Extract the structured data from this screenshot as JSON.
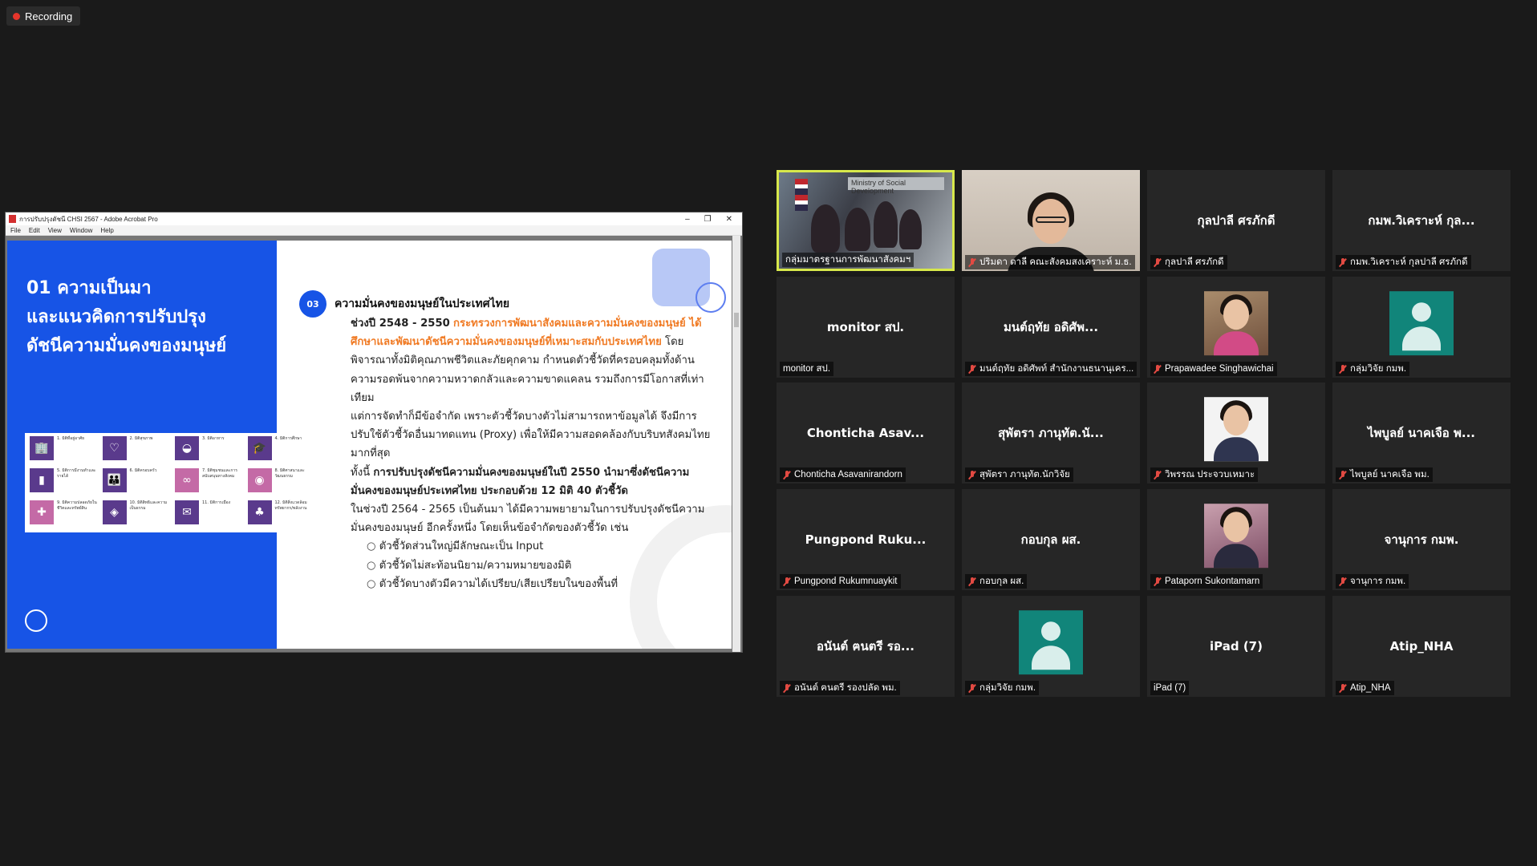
{
  "recording": {
    "label": "Recording"
  },
  "acrobat": {
    "title": "การปรับปรุงดัชนี CHSI 2567 - Adobe Acrobat Pro",
    "menu": [
      "File",
      "Edit",
      "View",
      "Window",
      "Help"
    ],
    "window_controls": [
      "‒",
      "❐",
      "✕"
    ]
  },
  "slide": {
    "heading": [
      "01 ความเป็นมา",
      "และแนวคิดการปรับปรุง",
      "ดัชนีความมั่นคงของมนุษย์"
    ],
    "section_number": "03",
    "section_title": "ความมั่นคงของมนุษย์ในประเทศไทย",
    "p1_lead": "ช่วงปี 2548 - 2550",
    "p1_orange": "กระทรวงการพัฒนาสังคมและความมั่นคงของมนุษย์ ได้ศึกษาและพัฒนาดัชนีความมั่นคงของมนุษย์ที่เหมาะสมกับประเทศไทย",
    "p1_rest": "โดยพิจารณาทั้งมิติคุณภาพชีวิตและภัยคุกคาม กำหนดตัวชี้วัดที่ครอบคลุมทั้งด้านความรอดพ้นจากความหวาดกลัวและความขาดแคลน รวมถึงการมีโอกาสที่เท่าเทียม",
    "p2": "แต่การจัดทำก็มีข้อจำกัด เพราะตัวชี้วัดบางตัวไม่สามารถหาข้อมูลได้ จึงมีการปรับใช้ตัวชี้วัดอื่นมาทดแทน (Proxy) เพื่อให้มีความสอดคล้องกับบริบทสังคมไทยมากที่สุด",
    "p3_lead": "ทั้งนี้",
    "p3_bold": "การปรับปรุงดัชนีความมั่นคงของมนุษย์ในปี 2550 นำมาซึ่งดัชนีความมั่นคงของมนุษย์ประเทศไทย ประกอบด้วย 12 มิติ 40 ตัวชี้วัด",
    "p4": "ในช่วงปี 2564 - 2565 เป็นต้นมา ได้มีความพยายามในการปรับปรุงดัชนีความมั่นคงของมนุษย์ อีกครั้งหนึ่ง โดยเห็นข้อจำกัดของตัวชี้วัด เช่น",
    "bullets": [
      "ตัวชี้วัดส่วนใหญ่มีลักษณะเป็น Input",
      "ตัวชี้วัดไม่สะท้อนนิยาม/ความหมายของมิติ",
      "ตัวชี้วัดบางตัวมีความได้เปรียบ/เสียเปรียบในของพื้นที่"
    ],
    "dimensions": [
      {
        "label": "1. มิติที่อยู่อาศัย",
        "icon": "🏢",
        "color": "#5a3a8c"
      },
      {
        "label": "2. มิติสุขภาพ",
        "icon": "♡",
        "color": "#5a3a8c"
      },
      {
        "label": "3. มิติอาหาร",
        "icon": "◒",
        "color": "#5a3a8c"
      },
      {
        "label": "4. มิติการศึกษา",
        "icon": "🎓",
        "color": "#5a3a8c"
      },
      {
        "label": "5. มิติการมีงานทำและรายได้",
        "icon": "▮",
        "color": "#5a3a8c"
      },
      {
        "label": "6. มิติครอบครัว",
        "icon": "👪",
        "color": "#5a3a8c"
      },
      {
        "label": "7. มิติชุมชนและการสนับสนุนทางสังคม",
        "icon": "∞",
        "color": "#c46aa6"
      },
      {
        "label": "8. มิติศาสนาและวัฒนธรรม",
        "icon": "◉",
        "color": "#c46aa6"
      },
      {
        "label": "9. มิติความปลอดภัยในชีวิตและทรัพย์สิน",
        "icon": "✚",
        "color": "#c46aa6"
      },
      {
        "label": "10. มิติสิทธิและความเป็นธรรม",
        "icon": "◈",
        "color": "#5a3a8c"
      },
      {
        "label": "11. มิติการเมือง",
        "icon": "✉",
        "color": "#5a3a8c"
      },
      {
        "label": "12. มิติสิ่งแวดล้อมทรัพยากร/พลังงาน",
        "icon": "♣",
        "color": "#5a3a8c"
      }
    ]
  },
  "participants": [
    {
      "tile_name": "",
      "label": "กลุ่มมาตรฐานการพัฒนาสังคมฯ",
      "type": "video-meeting",
      "muted": false,
      "active": true,
      "sign": "Ministry of Social Development"
    },
    {
      "tile_name": "",
      "label": "ปริมดา ตาลี  คณะสังคมสงเคราะห์ ม.ธ.",
      "type": "video-single",
      "muted": true
    },
    {
      "tile_name": "กุลปาลี ศรภักดี",
      "label": "กุลปาลี ศรภักดี",
      "type": "name",
      "muted": true
    },
    {
      "tile_name": "กมพ.วิเคราะห์ กุล...",
      "label": "กมพ.วิเคราะห์ กุลปาลี ศรภักดี",
      "type": "name",
      "muted": true
    },
    {
      "tile_name": "monitor สป.",
      "label": "monitor สป.",
      "type": "name",
      "muted": false
    },
    {
      "tile_name": "มนต์ฤทัย   อดิศัพ...",
      "label": "มนต์ฤทัย   อดิศัพท์ สำนักงานธนานุเคร...",
      "type": "name",
      "muted": true
    },
    {
      "tile_name": "",
      "label": "Prapawadee Singhawichai",
      "type": "photo-pink",
      "muted": true
    },
    {
      "tile_name": "",
      "label": "กลุ่มวิจัย กมพ.",
      "type": "generic",
      "muted": true
    },
    {
      "tile_name": "Chonticha  Asav...",
      "label": "Chonticha Asavanirandorn",
      "type": "name",
      "muted": true
    },
    {
      "tile_name": "สุพัตรา ภานุทัต.นั...",
      "label": "สุพัตรา ภานุทัต.นักวิจัย",
      "type": "name",
      "muted": true
    },
    {
      "tile_name": "",
      "label": "วิพรรณ ประจวบเหมาะ",
      "type": "photo-white",
      "muted": true
    },
    {
      "tile_name": "ไพบูลย์ นาคเจือ พ...",
      "label": "ไพบูลย์ นาคเจือ พม.",
      "type": "name",
      "muted": true
    },
    {
      "tile_name": "Pungpond  Ruku...",
      "label": "Pungpond Rukumnuaykit",
      "type": "name",
      "muted": true
    },
    {
      "tile_name": "กอบกุล ผส.",
      "label": "กอบกุล ผส.",
      "type": "name",
      "muted": true
    },
    {
      "tile_name": "",
      "label": "Pataporn Sukontamarn",
      "type": "photo-bright",
      "muted": true
    },
    {
      "tile_name": "จานุการ กมพ.",
      "label": "จานุการ กมพ.",
      "type": "name",
      "muted": true
    },
    {
      "tile_name": "อนันต์  ฅนตรี  รอ...",
      "label": "อนันต์  ฅนตรี  รองปลัด พม.",
      "type": "name",
      "muted": true
    },
    {
      "tile_name": "",
      "label": "กลุ่มวิจัย กมพ.",
      "type": "generic",
      "muted": true
    },
    {
      "tile_name": "iPad (7)",
      "label": "iPad (7)",
      "type": "name",
      "muted": false
    },
    {
      "tile_name": "Atip_NHA",
      "label": "Atip_NHA",
      "type": "name",
      "muted": true
    }
  ]
}
